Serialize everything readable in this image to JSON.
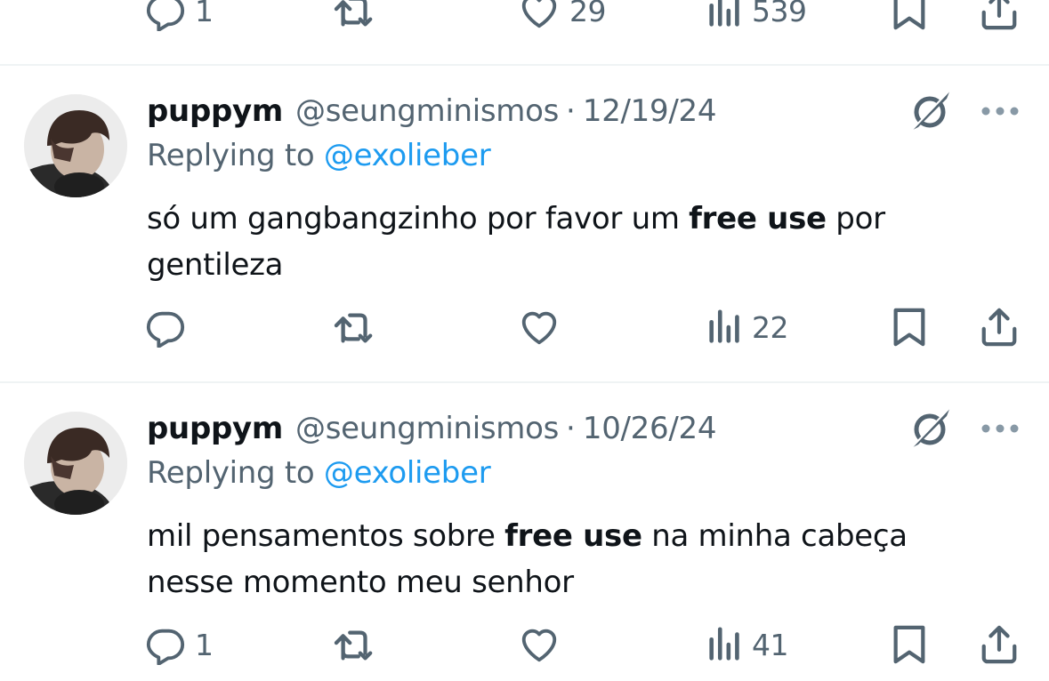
{
  "top_actions": {
    "reply_count": "1",
    "like_count": "29",
    "views_count": "539"
  },
  "tweets": [
    {
      "name": "puppym",
      "handle": "@seungminismos",
      "separator": "·",
      "date": "12/19/24",
      "replying_prefix": "Replying to ",
      "replying_to": "@exolieber",
      "text_before": "só um gangbangzinho por favor um ",
      "text_bold": "free use",
      "text_after": " por gentileza",
      "reply_count": "",
      "views_count": "22"
    },
    {
      "name": "puppym",
      "handle": "@seungminismos",
      "separator": "·",
      "date": "10/26/24",
      "replying_prefix": "Replying to ",
      "replying_to": "@exolieber",
      "text_before": "mil pensamentos sobre ",
      "text_bold": "free use",
      "text_after": " na minha cabeça nesse momento meu senhor",
      "reply_count": "1",
      "views_count": "41"
    }
  ],
  "icons": {
    "reply": "reply-icon",
    "retweet": "retweet-icon",
    "like": "heart-icon",
    "views": "views-icon",
    "bookmark": "bookmark-icon",
    "share": "share-icon",
    "grok": "grok-icon",
    "more": "more-icon"
  },
  "colors": {
    "text_primary": "#0f1419",
    "text_secondary": "#536471",
    "mention": "#1d9bf0",
    "divider": "#eff3f4"
  }
}
